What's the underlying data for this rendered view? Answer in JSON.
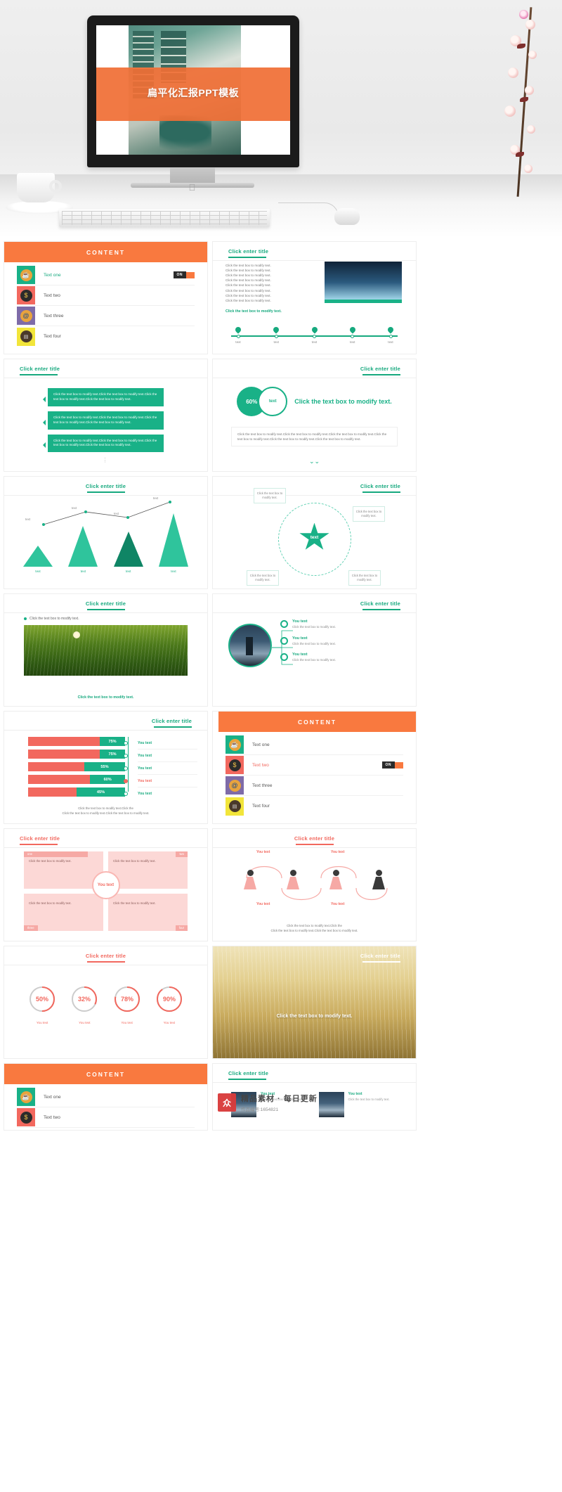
{
  "hero": {
    "slide_title": "扁平化汇报PPT模板",
    "brand_icon": "apple-logo-icon"
  },
  "colors": {
    "orange": "#f9793f",
    "green": "#19b187",
    "green_dark": "#16a97e",
    "red": "#f2685e",
    "pink": "#fcd8d6"
  },
  "common": {
    "title": "Click enter title",
    "body_line": "Click the text box to modify text.",
    "body_para": "Click the text box to modify text.Click the text box to modify text.Click the text box to modify text.Click the text box to modify text.",
    "caption": "Click the text box to modify text.",
    "foot_two_lines_a": "Click the text box to modify text.Click the",
    "foot_two_lines_b": "Click the text box to modify text.Click the text box to modify text."
  },
  "content_slide": {
    "header": "CONTENT",
    "on_label": "ON",
    "items": [
      {
        "label": "Text one",
        "icon": "coffee-cup-icon",
        "tile_color": "#19b187",
        "badge_color": "#e8a33d",
        "glyph": "☕"
      },
      {
        "label": "Text two",
        "icon": "money-exchange-icon",
        "tile_color": "#f2685e",
        "badge_color": "#2b2b2b",
        "glyph": "$"
      },
      {
        "label": "Text three",
        "icon": "email-at-icon",
        "tile_color": "#7e6ba8",
        "badge_color": "#e8a33d",
        "glyph": "@"
      },
      {
        "label": "Text four",
        "icon": "monitor-icon",
        "tile_color": "#f2e53a",
        "badge_color": "#4a3a2a",
        "glyph": "▤"
      }
    ]
  },
  "slide_text_timeline": {
    "title": "Click enter title",
    "paragraph_lines": [
      "Click the text box to modify text.",
      "Click the text box to modify text.",
      "Click the text box to modify text.",
      "Click the text box to modify text.",
      "Click the text box to modify text.",
      "Click the text box to modify text.",
      "Click the text box to modify text.",
      "Click the text box to modify text."
    ],
    "subcaption": "Click the text box to modify text.",
    "timeline": [
      {
        "label": "text"
      },
      {
        "label": "text"
      },
      {
        "label": "text"
      },
      {
        "label": "text"
      },
      {
        "label": "text"
      }
    ]
  },
  "slide_bubbles": {
    "title": "Click enter title",
    "bubbles": [
      "Click the text box to modify text.Click the text box to modify text.Click the text box to modify text.Click the text box to modify text.",
      "Click the text box to modify text.Click the text box to modify text.Click the text box to modify text.Click the text box to modify text.",
      "Click the text box to modify text.Click the text box to modify text.Click the text box to modify text.Click the text box to modify text."
    ],
    "more_dots": "⋮"
  },
  "slide_venn": {
    "title": "Click enter title",
    "percent": "60%",
    "circle_label": "text",
    "heading": "Click the text box to modify text.",
    "paragraph": "Click the text box to modify text.Click the text box to modify text.Click the text box to modify text.Click the text box to modify text.Click the text box to modify text.Click the text box to modify text.",
    "chevron": "⌄⌄"
  },
  "chart_data": [
    {
      "type": "bar",
      "title": "Click enter title",
      "categories": [
        "text",
        "text",
        "text",
        "text"
      ],
      "values": [
        38,
        72,
        62,
        95
      ],
      "series_labels": [
        "text",
        "text",
        "text",
        "text"
      ],
      "point_labels": [
        "text",
        "text",
        "text",
        "text"
      ],
      "colors": [
        "#19b187",
        "#19b187",
        "#0f8565",
        "#19b187"
      ],
      "overlay": {
        "type": "line",
        "values": [
          38,
          62,
          55,
          95
        ],
        "label": "text"
      },
      "xlabel": "",
      "ylabel": "",
      "grid": false,
      "legend": false
    },
    {
      "type": "bar",
      "title": "Click enter title",
      "orientation": "horizontal",
      "categories": [
        "You text",
        "You text",
        "You text",
        "You text",
        "You text"
      ],
      "values": [
        75,
        75,
        55,
        60,
        45
      ],
      "value_labels": [
        "75%",
        "75%",
        "55%",
        "60%",
        "45%"
      ],
      "track_color": "#f2685e",
      "fill_color": "#19b187",
      "xlim": [
        0,
        100
      ],
      "grid": false,
      "legend": false
    },
    {
      "type": "pie",
      "title": "Click enter title",
      "subtype": "donut-gauges",
      "labels": [
        "You text",
        "You text",
        "You text",
        "You text"
      ],
      "values": [
        50,
        32,
        78,
        90
      ],
      "value_labels": [
        "50%",
        "32%",
        "78%",
        "90%"
      ],
      "arc_color": "#f2685e",
      "track_color": "#cccccc"
    }
  ],
  "slide_star": {
    "title": "Click enter title",
    "center": "text",
    "nodes": [
      "Click the text box to modify text.",
      "Click the text box to modify text.",
      "Click the text box to modify text.",
      "Click the text box to modify text."
    ]
  },
  "slide_grass": {
    "title": "Click enter title",
    "bullet": "Click the text box to modify text.",
    "caption": "Click the text box to modify text."
  },
  "slide_citylist": {
    "title": "Click enter title",
    "rows": [
      {
        "title": "You text",
        "text": "Click the text box to modify text."
      },
      {
        "title": "You text",
        "text": "Click the text box to modify text."
      },
      {
        "title": "You text",
        "text": "Click the text box to modify text."
      }
    ]
  },
  "content_slide_2": {
    "header": "CONTENT",
    "on_label": "ON",
    "items": [
      {
        "label": "Text one",
        "icon": "coffee-cup-icon",
        "tile_color": "#19b187",
        "badge_color": "#e8a33d",
        "glyph": "☕"
      },
      {
        "label": "Text two",
        "icon": "money-exchange-icon",
        "tile_color": "#f2685e",
        "badge_color": "#2b2b2b",
        "glyph": "$"
      },
      {
        "label": "Text three",
        "icon": "email-at-icon",
        "tile_color": "#7e6ba8",
        "badge_color": "#e8a33d",
        "glyph": "@"
      },
      {
        "label": "Text four",
        "icon": "monitor-icon",
        "tile_color": "#f2e53a",
        "badge_color": "#4a3a2a",
        "glyph": "▤"
      }
    ]
  },
  "slide_quad": {
    "title": "Click enter title",
    "center": "You text",
    "cells": [
      {
        "tag": "one",
        "text": "Click the text box to modify text."
      },
      {
        "tag": "two",
        "text": "Click the text box to modify text."
      },
      {
        "tag": "three",
        "text": "Click the text box to modify text."
      },
      {
        "tag": "four",
        "text": "Click the text box to modify text."
      }
    ]
  },
  "slide_people": {
    "title": "Click enter title",
    "top_labels": [
      "You text",
      "You text"
    ],
    "bottom_labels": [
      "You text",
      "You text"
    ],
    "footer_a": "Click the text box to modify text.Click the",
    "footer_b": "Click the text box to modify text.Click the text box to modify text."
  },
  "slide_wheat": {
    "title": "Click enter title",
    "caption": "Click the text box to modify\nmodify text."
  },
  "slide_cards": {
    "title": "Click enter title",
    "cards": [
      {
        "title": "You text",
        "text": "Click the text box to modify text."
      },
      {
        "title": "You text",
        "text": "Click the text box to modify text."
      }
    ]
  },
  "content_slide_3": {
    "header": "CONTENT",
    "items": [
      {
        "label": "Text one",
        "icon": "coffee-cup-icon",
        "tile_color": "#19b187",
        "badge_color": "#e8a33d",
        "glyph": "☕"
      },
      {
        "label": "Text two",
        "icon": "money-exchange-icon",
        "tile_color": "#f2685e",
        "badge_color": "#2b2b2b",
        "glyph": "$"
      }
    ]
  },
  "watermark": {
    "badge": "众",
    "main": "精品素材 · 每日更新",
    "sub": "作品编号:1654821"
  }
}
